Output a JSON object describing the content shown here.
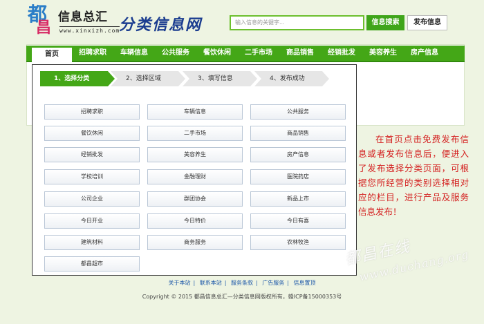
{
  "logo": {
    "char_top": "都",
    "char_bottom": "昌",
    "name": "信息总汇",
    "url": "www.xinxizh.com"
  },
  "slogan": "分类信息网",
  "search": {
    "placeholder": "输入信息的关键字...",
    "search_label": "信息搜索",
    "post_label": "发布信息"
  },
  "nav": {
    "items": [
      "首页",
      "招聘求职",
      "车辆信息",
      "公共服务",
      "餐饮休闲",
      "二手市场",
      "商品销售",
      "经销批发",
      "美容养生",
      "房产信息"
    ]
  },
  "steps": [
    "1、选择分类",
    "2、选择区域",
    "3、填写信息",
    "4、发布成功"
  ],
  "categories": [
    "招聘求职",
    "车辆信息",
    "公共服务",
    "餐饮休闲",
    "二手市场",
    "商品销售",
    "经销批发",
    "美容养生",
    "房产信息",
    "学校培训",
    "金融理财",
    "医院药店",
    "公司企业",
    "群团协会",
    "新品上市",
    "今日开业",
    "今日特价",
    "今日有喜",
    "建筑材料",
    "商务服务",
    "农林牧渔",
    "都昌超市"
  ],
  "annotation": "在首页点击免费发布信息或者发布信息后，便进入了发布选择分类页面，可根据您所经营的类别选择相对应的栏目，进行产品及服务信息发布！",
  "watermark": {
    "line1": "都昌在线",
    "line2": "www.duchang.org"
  },
  "footer": {
    "links": [
      "关于本站",
      "联系本站",
      "服务条款",
      "广告服务",
      "信息置顶"
    ],
    "copyright": "Copyright © 2015 都昌信息总汇—分类信息网版权所有，赣ICP备15000353号"
  }
}
